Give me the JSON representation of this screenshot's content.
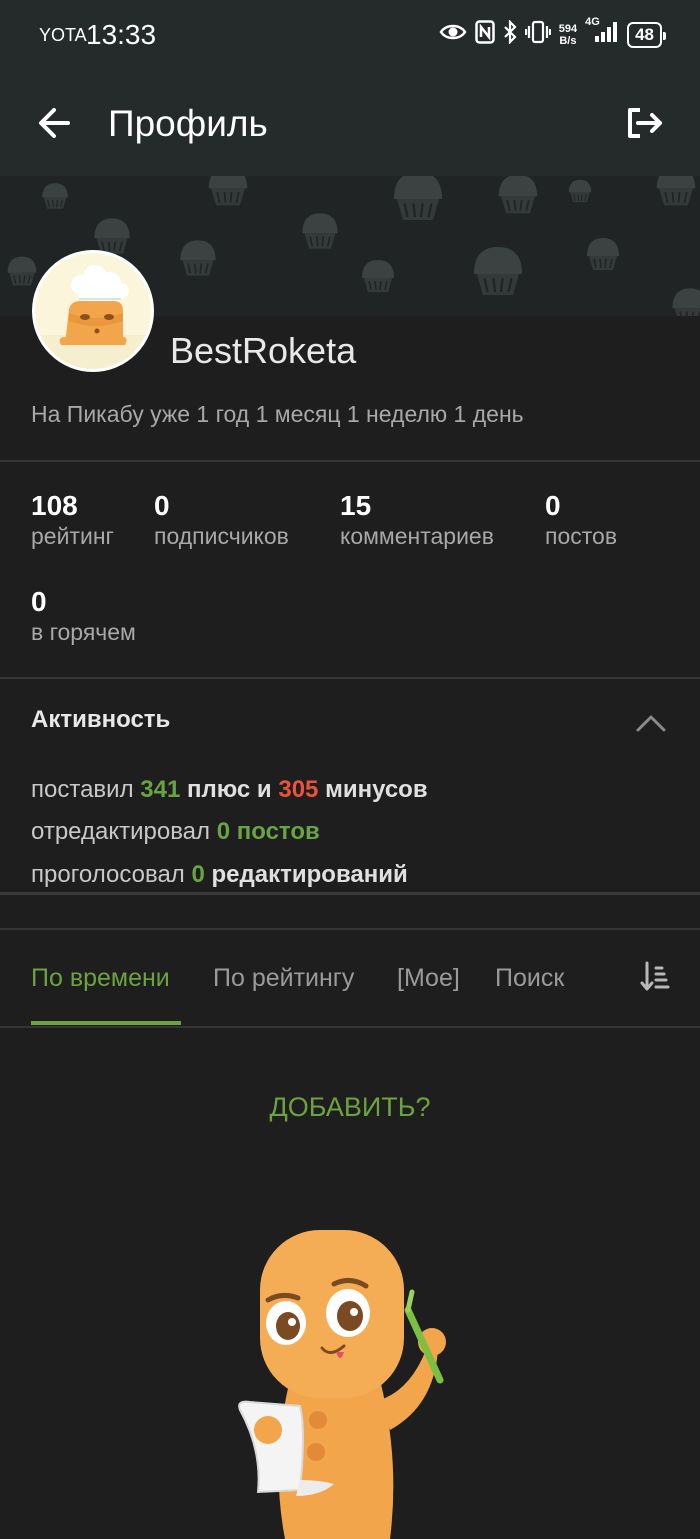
{
  "status_bar": {
    "carrier": "YOTA",
    "time": "13:33",
    "speed_value": "594",
    "speed_unit": "B/s",
    "network": "4G",
    "battery": "48",
    "icons": [
      "eye-icon",
      "nfc-icon",
      "bluetooth-icon",
      "vibrate-icon",
      "signal-icon"
    ]
  },
  "header": {
    "title": "Профиль",
    "back_icon": "arrow-left-icon",
    "logout_icon": "logout-icon"
  },
  "profile": {
    "username": "BestRoketa",
    "member_since": "На Пикабу уже 1 год 1 месяц 1 неделю 1 день"
  },
  "stats": [
    {
      "value": "108",
      "label": "рейтинг"
    },
    {
      "value": "0",
      "label": "подписчиков"
    },
    {
      "value": "15",
      "label": "комментариев"
    },
    {
      "value": "0",
      "label": "постов"
    },
    {
      "value": "0",
      "label": "в горячем"
    }
  ],
  "activity": {
    "title": "Активность",
    "line1": {
      "prefix": "поставил",
      "plus_count": "341",
      "plus_word": "плюс и",
      "minus_count": "305",
      "minus_word": "минусов"
    },
    "line2": {
      "prefix": "отредактировал",
      "count": "0",
      "word": "постов"
    },
    "line3": {
      "prefix": "проголосовал",
      "count": "0",
      "word": "редактирований"
    }
  },
  "tabs": [
    {
      "label": "По времени",
      "active": true
    },
    {
      "label": "По рейтингу",
      "active": false
    },
    {
      "label": "[Мое]",
      "active": false
    },
    {
      "label": "Поиск",
      "active": false
    }
  ],
  "empty_state": {
    "add_label": "ДОБАВИТЬ?"
  },
  "colors": {
    "accent_green": "#6aa340",
    "minus_red": "#e8523e",
    "background": "#1e1e1e",
    "header_bg": "#252a2b"
  }
}
